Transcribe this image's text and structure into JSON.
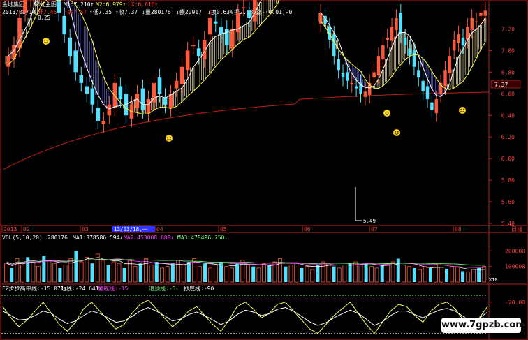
{
  "header": {
    "date": "2013/08/14",
    "name": "金地集团",
    "main_chart": "彩虹主图",
    "items": [
      {
        "text": "开7.46",
        "color": "#ff4040"
      },
      {
        "text": "↑高7.57",
        "color": "#ff4040"
      },
      {
        "text": "↑低7.35",
        "color": "#ffffff"
      },
      {
        "text": "↑收7.37",
        "color": "#ffffff"
      },
      {
        "text": "↓量280176",
        "color": "#ffffff"
      },
      {
        "text": "↓额20917",
        "color": "#ffffff"
      },
      {
        "text": "↓换0.63%",
        "color": "#ffffff"
      },
      {
        "text": "振2.98%",
        "color": "#ffffff"
      },
      {
        "text": "涨-(0.01)-0",
        "color": "#ffffff"
      }
    ],
    "mas": [
      {
        "text": "M1:7.210↑",
        "color": "#ffffff"
      },
      {
        "text": "M2:6.979↑",
        "color": "#ffff40"
      },
      {
        "text": "LX:6.610↑",
        "color": "#ff4040"
      }
    ]
  },
  "price_panel": {
    "y_ticks": [
      "7.20",
      "7.00",
      "6.80",
      "6.60",
      "6.40",
      "6.20",
      "6.00",
      "5.80",
      "5.60",
      "5.40"
    ],
    "high_label": "8.25",
    "low_label": "5.49",
    "last_price": "7.37"
  },
  "time_axis": {
    "labels": [
      "2013",
      "02",
      "03",
      "04",
      "05",
      "06",
      "07",
      "08"
    ],
    "highlight": "13/03/18,一"
  },
  "period": "日线",
  "volume_panel": {
    "label": "VOL(5,10,20)",
    "vol": "280176",
    "items": [
      {
        "text": "MA1:378586.594↓",
        "color": "#ffffff"
      },
      {
        "text": "MA2:453008.688↓",
        "color": "#ff40ff"
      },
      {
        "text": "MA3:478496.750↓",
        "color": "#80ff80"
      }
    ],
    "y_ticks": [
      "200000",
      "100000"
    ],
    "unit": "X10"
  },
  "indicator_panel": {
    "label": "FZ步步高",
    "items": [
      {
        "text": "中线:-15.071↓",
        "color": "#ffffff"
      },
      {
        "text": "短线:-24.641↓",
        "color": "#ffffff"
      },
      {
        "text": "警戒线:-15",
        "color": "#ff40ff"
      },
      {
        "text": "追顶线:-5",
        "color": "#80ff80"
      },
      {
        "text": "抄底线:-90",
        "color": "#ffffff"
      }
    ],
    "y_ticks": [
      "-20.00"
    ]
  },
  "watermark": "www.7gpzb.com",
  "colors": {
    "up": "#ff5a3c",
    "down": "#54e0ff",
    "ribbon_up": "#f0e6b0",
    "ribbon_down": "#6a6adc",
    "lx": "#c0201a",
    "axis": "#b02020",
    "label_blue": "#3030ff"
  },
  "chart_data": [
    {
      "type": "candlestick",
      "title": "彩虹主图",
      "ylim": [
        5.4,
        7.3
      ],
      "series_names": [
        "M1",
        "M2",
        "LX"
      ],
      "last": {
        "open": 7.46,
        "high": 7.57,
        "low": 7.35,
        "close": 7.37,
        "M1": 7.21,
        "M2": 6.979,
        "LX": 6.61
      },
      "marked_high": 8.25,
      "marked_low": 5.49,
      "segments": [
        {
          "closes": [
            6.95,
            7.05,
            7.3,
            7.5,
            7.7,
            7.95,
            8.1,
            7.9,
            7.6,
            7.35,
            7.15,
            6.95,
            6.8,
            6.7,
            6.6,
            6.5,
            6.35,
            6.35,
            6.5,
            6.7,
            6.55,
            6.4,
            6.5,
            6.6,
            6.45,
            6.55,
            6.7,
            6.6,
            6.5,
            6.6,
            6.72,
            6.85,
            7.0,
            7.05,
            6.95,
            7.1,
            7.3,
            7.25,
            7.15,
            7.05,
            7.2,
            7.35,
            7.4,
            7.3,
            7.5,
            7.7,
            7.85,
            7.8,
            7.95,
            8.05,
            8.2,
            8.15
          ]
        },
        {
          "closes": [
            7.35,
            7.25,
            7.1,
            6.95,
            6.82,
            6.75,
            6.72,
            6.7,
            6.65,
            6.6,
            6.62,
            6.7,
            6.8,
            6.95,
            7.05,
            7.12,
            7.22,
            7.3,
            7.15,
            7.05,
            6.95,
            6.85,
            6.75,
            6.62,
            6.55,
            6.45,
            6.55,
            6.7,
            6.82,
            6.95,
            7.1,
            7.15,
            7.05,
            7.22,
            7.3,
            7.27,
            7.35,
            7.37
          ]
        }
      ]
    },
    {
      "type": "bar",
      "title": "VOL(5,10,20)",
      "ylim": [
        0,
        260000
      ],
      "values": [
        120000,
        90000,
        150000,
        110000,
        160000,
        130000,
        100000,
        170000,
        140000,
        120000,
        90000,
        110000,
        150000,
        200000,
        130000,
        160000,
        120000,
        180000,
        140000,
        110000,
        130000,
        120000,
        90000,
        140000,
        100000,
        120000,
        150000,
        110000,
        130000,
        90000,
        100000,
        120000,
        140000,
        110000,
        130000,
        150000,
        100000,
        120000,
        90000,
        110000,
        130000,
        100000,
        90000,
        120000,
        140000,
        110000,
        100000,
        90000,
        120000,
        110000,
        130000,
        150000,
        100000,
        110000,
        120000,
        90000,
        100000,
        80000,
        110000,
        130000,
        120000,
        100000,
        90000,
        110000,
        120000,
        130000,
        110000,
        120000,
        100000,
        90000,
        110000,
        120000,
        130000,
        150000,
        110000,
        100000,
        90000,
        80000,
        100000,
        90000,
        110000,
        95000,
        85000,
        100000,
        95000,
        70000,
        65000,
        80000,
        90000,
        100000
      ]
    },
    {
      "type": "line",
      "title": "FZ步步高",
      "ylim": [
        -100,
        0
      ],
      "series": [
        {
          "name": "短线",
          "values": [
            -30,
            -55,
            -75,
            -60,
            -40,
            -20,
            -45,
            -70,
            -85,
            -65,
            -35,
            -20,
            -40,
            -60,
            -80,
            -70,
            -45,
            -25,
            -15,
            -35,
            -55,
            -75,
            -60,
            -40,
            -30,
            -50,
            -70,
            -85,
            -60,
            -30,
            -20,
            -35,
            -55,
            -45,
            -25,
            -20,
            -40,
            -60,
            -80,
            -90,
            -70,
            -50,
            -35,
            -20,
            -45,
            -70,
            -90,
            -65,
            -40,
            -25,
            -30,
            -50,
            -65,
            -40,
            -25,
            -20,
            -35,
            -60,
            -80,
            -55,
            -30
          ]
        },
        {
          "name": "中线",
          "values": [
            -40,
            -50,
            -60,
            -58,
            -50,
            -40,
            -45,
            -58,
            -68,
            -62,
            -50,
            -40,
            -45,
            -55,
            -65,
            -62,
            -52,
            -40,
            -32,
            -40,
            -50,
            -62,
            -58,
            -48,
            -42,
            -50,
            -60,
            -70,
            -62,
            -48,
            -38,
            -42,
            -50,
            -46,
            -36,
            -32,
            -40,
            -52,
            -64,
            -72,
            -66,
            -55,
            -46,
            -38,
            -45,
            -58,
            -72,
            -64,
            -50,
            -40,
            -40,
            -48,
            -55,
            -46,
            -38,
            -34,
            -40,
            -52,
            -64,
            -56,
            -42
          ]
        }
      ]
    }
  ]
}
